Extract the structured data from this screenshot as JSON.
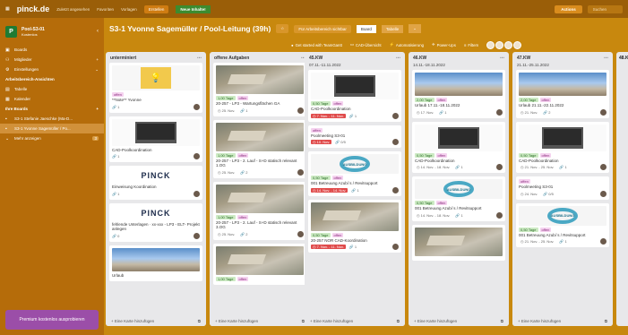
{
  "topbar": {
    "logo": "pinck.de",
    "nav": [
      "Zuletzt angesehen",
      "Favoriten",
      "Vorlagen"
    ],
    "create": "Erstellen",
    "new_features": "Neue Inhalte!",
    "actions": "Actions",
    "search": "Suchen"
  },
  "sidebar": {
    "workspace_name": "Pool-S3-01",
    "workspace_sub": "Kostenlos",
    "workspace_letter": "P",
    "items": [
      {
        "icon": "boards-icon",
        "label": "Boards"
      },
      {
        "icon": "members-icon",
        "label": "Mitglieder"
      },
      {
        "icon": "settings-icon",
        "label": "Einstellungen"
      }
    ],
    "views_title": "Arbeitsbereich-Ansichten",
    "views": [
      {
        "label": "Tabelle"
      },
      {
        "label": "Kalender"
      }
    ],
    "boards_title": "Ihre Boards",
    "boards": [
      {
        "label": "S3-1 Stefanie Jaeschke (Ma-D..."
      },
      {
        "label": "S3-1 Yvonne Sagemüller / Po..."
      }
    ],
    "more_label": "Mehr anzeigen",
    "more_count": "3",
    "premium": "Premium kostenlos ausprobieren"
  },
  "board": {
    "title": "S3-1 Yvonne Sagemüller / Pool-Leitung (39h)",
    "visibility": "Für Arbeitsbereich sichtbar",
    "view_board": "Board",
    "view_table": "Tabelle"
  },
  "toolbar": {
    "teamgantt": "Get started with TeamGantt",
    "cad": "CAD-Übersicht",
    "automation": "Automatisierung",
    "powerups": "Power-Ups",
    "filter": "Filtern"
  },
  "lists": [
    {
      "title": "unterminiert",
      "sub": "",
      "footer": "+ Eine Karte hinzufügen",
      "cards": [
        {
          "cover": "note",
          "labels": [
            [
              "pink",
              "offen"
            ]
          ],
          "text": "**Note** Yvonne",
          "meta": "1"
        },
        {
          "cover": "laptop",
          "labels": [],
          "text": "CAD-Poolkoordination",
          "meta": "1"
        },
        {
          "cover": "logo",
          "cover_text": "PINCK",
          "labels": [],
          "text": "Einweisung Koordination",
          "meta": "1"
        },
        {
          "cover": "logo",
          "cover_text": "PINCK",
          "labels": [],
          "text": "fehlende Unterlagen · xx-xxx - LP3 - ELT- Projekt anlegen",
          "meta": "0"
        },
        {
          "cover": "sky",
          "labels": [],
          "text": "Urlaub",
          "meta": ""
        }
      ]
    },
    {
      "title": "offene Aufgaben",
      "sub": "",
      "footer": "+ Eine Karte hinzufügen",
      "cards": [
        {
          "cover": "aerial",
          "labels": [
            [
              "green",
              "1,00 Tage"
            ],
            [
              "pink",
              "offen"
            ]
          ],
          "text": "20-257 - LP3 - Wartungsflächen GA",
          "date": "25. Nov.",
          "meta": "1"
        },
        {
          "cover": "aerial",
          "labels": [
            [
              "green",
              "1,00 Tage"
            ],
            [
              "pink",
              "offen"
            ]
          ],
          "text": "20-257 - LP3 - 2. Lauf - S+D statisch relevant 1.OG",
          "date": "25. Nov.",
          "meta": "2"
        },
        {
          "cover": "aerial",
          "labels": [
            [
              "green",
              "1,00 Tage"
            ],
            [
              "pink",
              "offen"
            ]
          ],
          "text": "20-257 - LP3 - 2. Lauf - S+D statisch relevant 3.OG",
          "date": "25. Nov.",
          "meta": "2"
        },
        {
          "cover": "aerial",
          "labels": [
            [
              "green",
              "1,00 Tage"
            ],
            [
              "pink",
              "offen"
            ]
          ],
          "text": "",
          "meta": ""
        }
      ]
    },
    {
      "title": "45.KW",
      "sub": "07.11.-11.11.2022",
      "footer": "+ Eine Karte hinzufügen",
      "cards": [
        {
          "cover": "laptop",
          "labels": [
            [
              "green",
              "0,50 Tage"
            ],
            [
              "pink",
              "offen"
            ]
          ],
          "text": "CAD-Poolkoordination",
          "date": "7. Nov. - 11. Nov.",
          "date_red": true,
          "meta": "1"
        },
        {
          "cover": "",
          "labels": [
            [
              "pink",
              "offen"
            ]
          ],
          "text": "Poolmeeting S3-01",
          "date": "10. Nov.",
          "date_red": true,
          "meta": "0/5"
        },
        {
          "cover": "ausb",
          "cover_text": "AUSBILDUNG",
          "labels": [
            [
              "green",
              "0,50 Tage"
            ],
            [
              "pink",
              "offen"
            ]
          ],
          "text": "001 Betreuung Azubi´s / Revitsupport",
          "date": "14. Nov. - 14. Nov.",
          "date_red": true,
          "meta": "1"
        },
        {
          "cover": "aerial",
          "labels": [
            [
              "green",
              "0,50 Tage"
            ],
            [
              "pink",
              "offen"
            ]
          ],
          "text": "20-257 NOR CAD-Koordination",
          "date": "7. Nov. - 11. Nov.",
          "date_red": true,
          "meta": "1"
        }
      ]
    },
    {
      "title": "46.KW",
      "sub": "14.11.-18.11.2022",
      "footer": "+ Eine Karte hinzufügen",
      "cards": [
        {
          "cover": "sky",
          "labels": [
            [
              "green",
              "2,00 Tage"
            ],
            [
              "pink",
              "offen"
            ]
          ],
          "text": "Urlaub 17.11.-18.11.2022",
          "date": "17. Nov.",
          "meta": "1"
        },
        {
          "cover": "laptop",
          "labels": [
            [
              "green",
              "0,50 Tage"
            ],
            [
              "pink",
              "offen"
            ]
          ],
          "text": "CAD-Poolkoordination",
          "date": "14. Nov. - 18. Nov.",
          "meta": "1"
        },
        {
          "cover": "ausb",
          "cover_text": "AUSBILDUNG",
          "labels": [
            [
              "green",
              "0,50 Tage"
            ],
            [
              "pink",
              "offen"
            ]
          ],
          "text": "001 Betreuung Azubi´s / Revitsupport",
          "date": "14. Nov. - 18. Nov.",
          "meta": "1"
        },
        {
          "cover": "aerial",
          "labels": [],
          "text": "",
          "meta": ""
        }
      ]
    },
    {
      "title": "47.KW",
      "sub": "21.11.-25.11.2022",
      "footer": "+ Eine Karte hinzufügen",
      "cards": [
        {
          "cover": "sky",
          "labels": [
            [
              "green",
              "2,00 Tage"
            ],
            [
              "pink",
              "offen"
            ]
          ],
          "text": "Urlaub 21.11.-22.11.2022",
          "date": "21. Nov.",
          "meta": "2"
        },
        {
          "cover": "laptop",
          "labels": [
            [
              "green",
              "0,50 Tage"
            ],
            [
              "pink",
              "offen"
            ]
          ],
          "text": "CAD-Poolkoordination",
          "date": "21. Nov. - 25. Nov.",
          "meta": "1"
        },
        {
          "cover": "",
          "labels": [
            [
              "pink",
              "offen"
            ]
          ],
          "text": "Poolmeeting S3-01",
          "date": "24. Nov.",
          "meta": "0/5"
        },
        {
          "cover": "ausb",
          "cover_text": "AUSBILDUNG",
          "labels": [
            [
              "green",
              "0,50 Tage"
            ],
            [
              "pink",
              "offen"
            ]
          ],
          "text": "001 Betreuung Azubi´s / Revitsupport",
          "date": "21. Nov. - 25. Nov.",
          "meta": "1"
        }
      ]
    }
  ],
  "partial_list": {
    "title": "48.KW"
  }
}
